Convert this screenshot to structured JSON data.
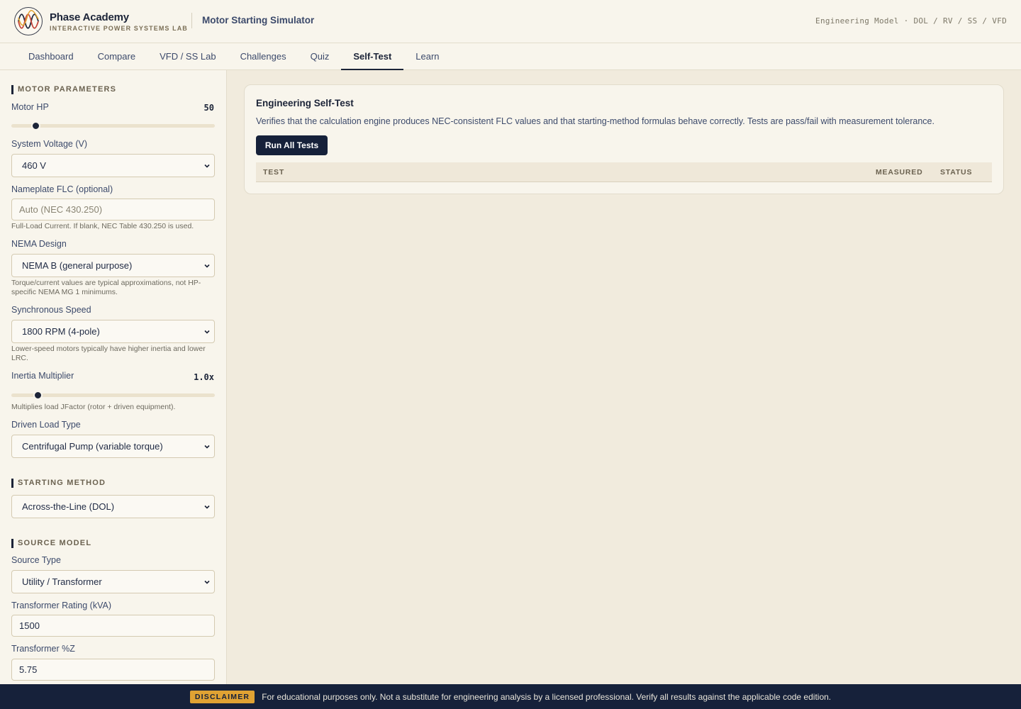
{
  "header": {
    "brand_name": "Phase Academy",
    "brand_sub": "INTERACTIVE POWER SYSTEMS LAB",
    "app_title": "Motor Starting Simulator",
    "meta": "Engineering Model · DOL / RV / SS / VFD"
  },
  "tabs": [
    {
      "label": "Dashboard"
    },
    {
      "label": "Compare"
    },
    {
      "label": "VFD / SS Lab"
    },
    {
      "label": "Challenges"
    },
    {
      "label": "Quiz"
    },
    {
      "label": "Self-Test"
    },
    {
      "label": "Learn"
    }
  ],
  "active_tab": "Self-Test",
  "sidebar": {
    "motor_parameters": {
      "heading": "MOTOR PARAMETERS",
      "motor_hp": {
        "label": "Motor HP",
        "value": "50",
        "fraction": 0.12
      },
      "system_voltage": {
        "label": "System Voltage (V)",
        "selected": "460 V"
      },
      "nameplate_flc": {
        "label": "Nameplate FLC (optional)",
        "placeholder": "Auto (NEC 430.250)",
        "hint": "Full-Load Current. If blank, NEC Table 430.250 is used."
      },
      "nema_design": {
        "label": "NEMA Design",
        "selected": "NEMA B (general purpose)",
        "hint": "Torque/current values are typical approximations, not HP-specific NEMA MG 1 minimums."
      },
      "sync_speed": {
        "label": "Synchronous Speed",
        "selected": "1800 RPM (4-pole)",
        "hint": "Lower-speed motors typically have higher inertia and lower LRC."
      },
      "inertia": {
        "label": "Inertia Multiplier",
        "value": "1.0x",
        "fraction": 0.13,
        "hint": "Multiplies load JFactor (rotor + driven equipment)."
      },
      "load_type": {
        "label": "Driven Load Type",
        "selected": "Centrifugal Pump (variable torque)"
      }
    },
    "starting_method": {
      "heading": "STARTING METHOD",
      "selected": "Across-the-Line (DOL)"
    },
    "source_model": {
      "heading": "SOURCE MODEL",
      "source_type": {
        "label": "Source Type",
        "selected": "Utility / Transformer"
      },
      "transformer_kva": {
        "label": "Transformer Rating (kVA)",
        "value": "1500"
      },
      "transformer_z": {
        "label": "Transformer %Z",
        "value": "5.75"
      }
    }
  },
  "main": {
    "title": "Engineering Self-Test",
    "description": "Verifies that the calculation engine produces NEC-consistent FLC values and that starting-method formulas behave correctly. Tests are pass/fail with measurement tolerance.",
    "run_button": "Run All Tests",
    "columns": [
      "TEST",
      "MEASURED",
      "STATUS"
    ]
  },
  "footer": {
    "badge": "DISCLAIMER",
    "text": "For educational purposes only. Not a substitute for engineering analysis by a licensed professional. Verify all results against the applicable code edition."
  },
  "colors": {
    "navy": "#16213a",
    "accent": "#e0a233",
    "panel": "#f8f5ec",
    "background": "#f1ebdd"
  }
}
